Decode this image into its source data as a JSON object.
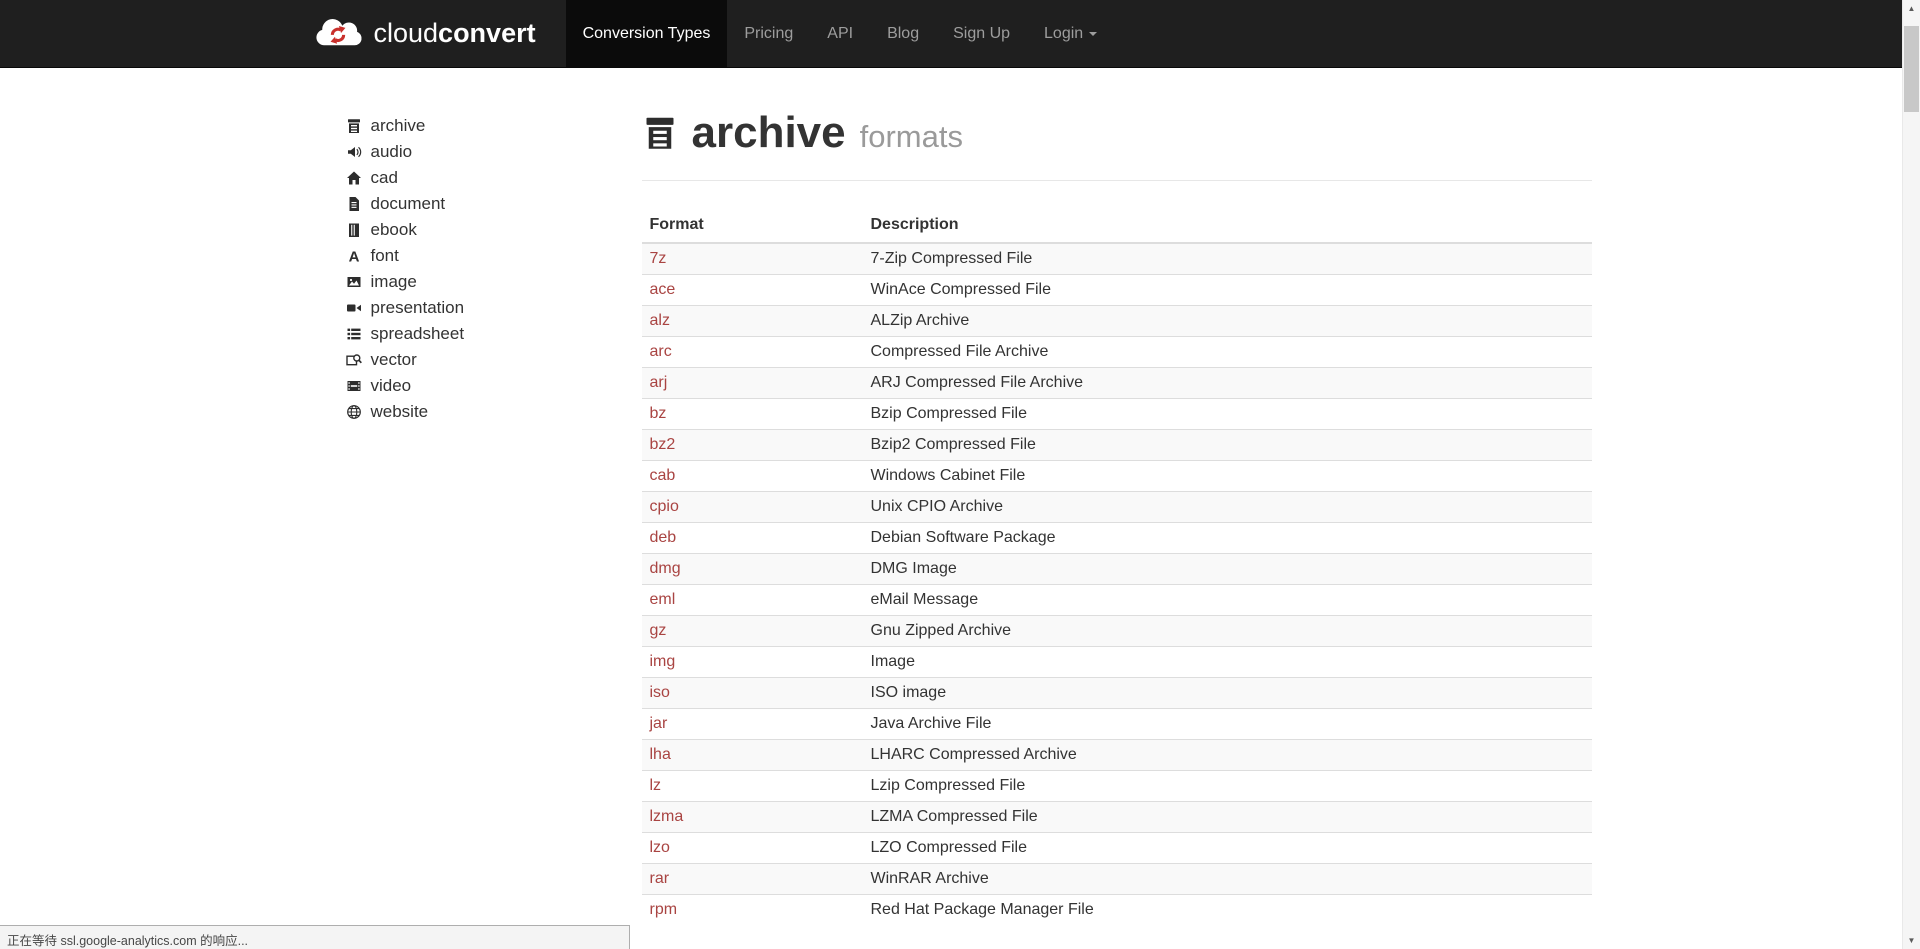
{
  "navbar": {
    "brand_cloud": "cloud",
    "brand_convert": "convert",
    "items": [
      {
        "label": "Conversion Types",
        "active": true
      },
      {
        "label": "Pricing",
        "active": false
      },
      {
        "label": "API",
        "active": false
      },
      {
        "label": "Blog",
        "active": false
      }
    ],
    "right_items": [
      {
        "label": "Sign Up",
        "has_caret": false
      },
      {
        "label": "Login",
        "has_caret": true
      }
    ]
  },
  "sidebar": {
    "items": [
      {
        "icon": "archive-icon",
        "label": "archive"
      },
      {
        "icon": "audio-icon",
        "label": "audio"
      },
      {
        "icon": "cad-icon",
        "label": "cad"
      },
      {
        "icon": "document-icon",
        "label": "document"
      },
      {
        "icon": "ebook-icon",
        "label": "ebook"
      },
      {
        "icon": "font-icon",
        "label": "font"
      },
      {
        "icon": "image-icon",
        "label": "image"
      },
      {
        "icon": "presentation-icon",
        "label": "presentation"
      },
      {
        "icon": "spreadsheet-icon",
        "label": "spreadsheet"
      },
      {
        "icon": "vector-icon",
        "label": "vector"
      },
      {
        "icon": "video-icon",
        "label": "video"
      },
      {
        "icon": "website-icon",
        "label": "website"
      }
    ]
  },
  "main": {
    "title": "archive",
    "subtitle": "formats",
    "title_icon": "archive-icon",
    "table": {
      "headers": [
        "Format",
        "Description"
      ],
      "rows": [
        {
          "format": "7z",
          "description": "7-Zip Compressed File"
        },
        {
          "format": "ace",
          "description": "WinAce Compressed File"
        },
        {
          "format": "alz",
          "description": "ALZip Archive"
        },
        {
          "format": "arc",
          "description": "Compressed File Archive"
        },
        {
          "format": "arj",
          "description": "ARJ Compressed File Archive"
        },
        {
          "format": "bz",
          "description": "Bzip Compressed File"
        },
        {
          "format": "bz2",
          "description": "Bzip2 Compressed File"
        },
        {
          "format": "cab",
          "description": "Windows Cabinet File"
        },
        {
          "format": "cpio",
          "description": "Unix CPIO Archive"
        },
        {
          "format": "deb",
          "description": "Debian Software Package"
        },
        {
          "format": "dmg",
          "description": "DMG Image"
        },
        {
          "format": "eml",
          "description": "eMail Message"
        },
        {
          "format": "gz",
          "description": "Gnu Zipped Archive"
        },
        {
          "format": "img",
          "description": "Image"
        },
        {
          "format": "iso",
          "description": "ISO image"
        },
        {
          "format": "jar",
          "description": "Java Archive File"
        },
        {
          "format": "lha",
          "description": "LHARC Compressed Archive"
        },
        {
          "format": "lz",
          "description": "Lzip Compressed File"
        },
        {
          "format": "lzma",
          "description": "LZMA Compressed File"
        },
        {
          "format": "lzo",
          "description": "LZO Compressed File"
        },
        {
          "format": "rar",
          "description": "WinRAR Archive"
        },
        {
          "format": "rpm",
          "description": "Red Hat Package Manager File"
        }
      ]
    }
  },
  "statusbar": {
    "text": "正在等待 ssl.google-analytics.com 的响应..."
  },
  "colors": {
    "navbar_bg": "#1f1f1f",
    "navbar_active_bg": "#0b0b0b",
    "navbar_link": "#9d9d9d",
    "link_red": "#a94442",
    "logo_red": "#c9302c",
    "stripe": "#f9f9f9",
    "subtitle_gray": "#9a9a9a"
  }
}
